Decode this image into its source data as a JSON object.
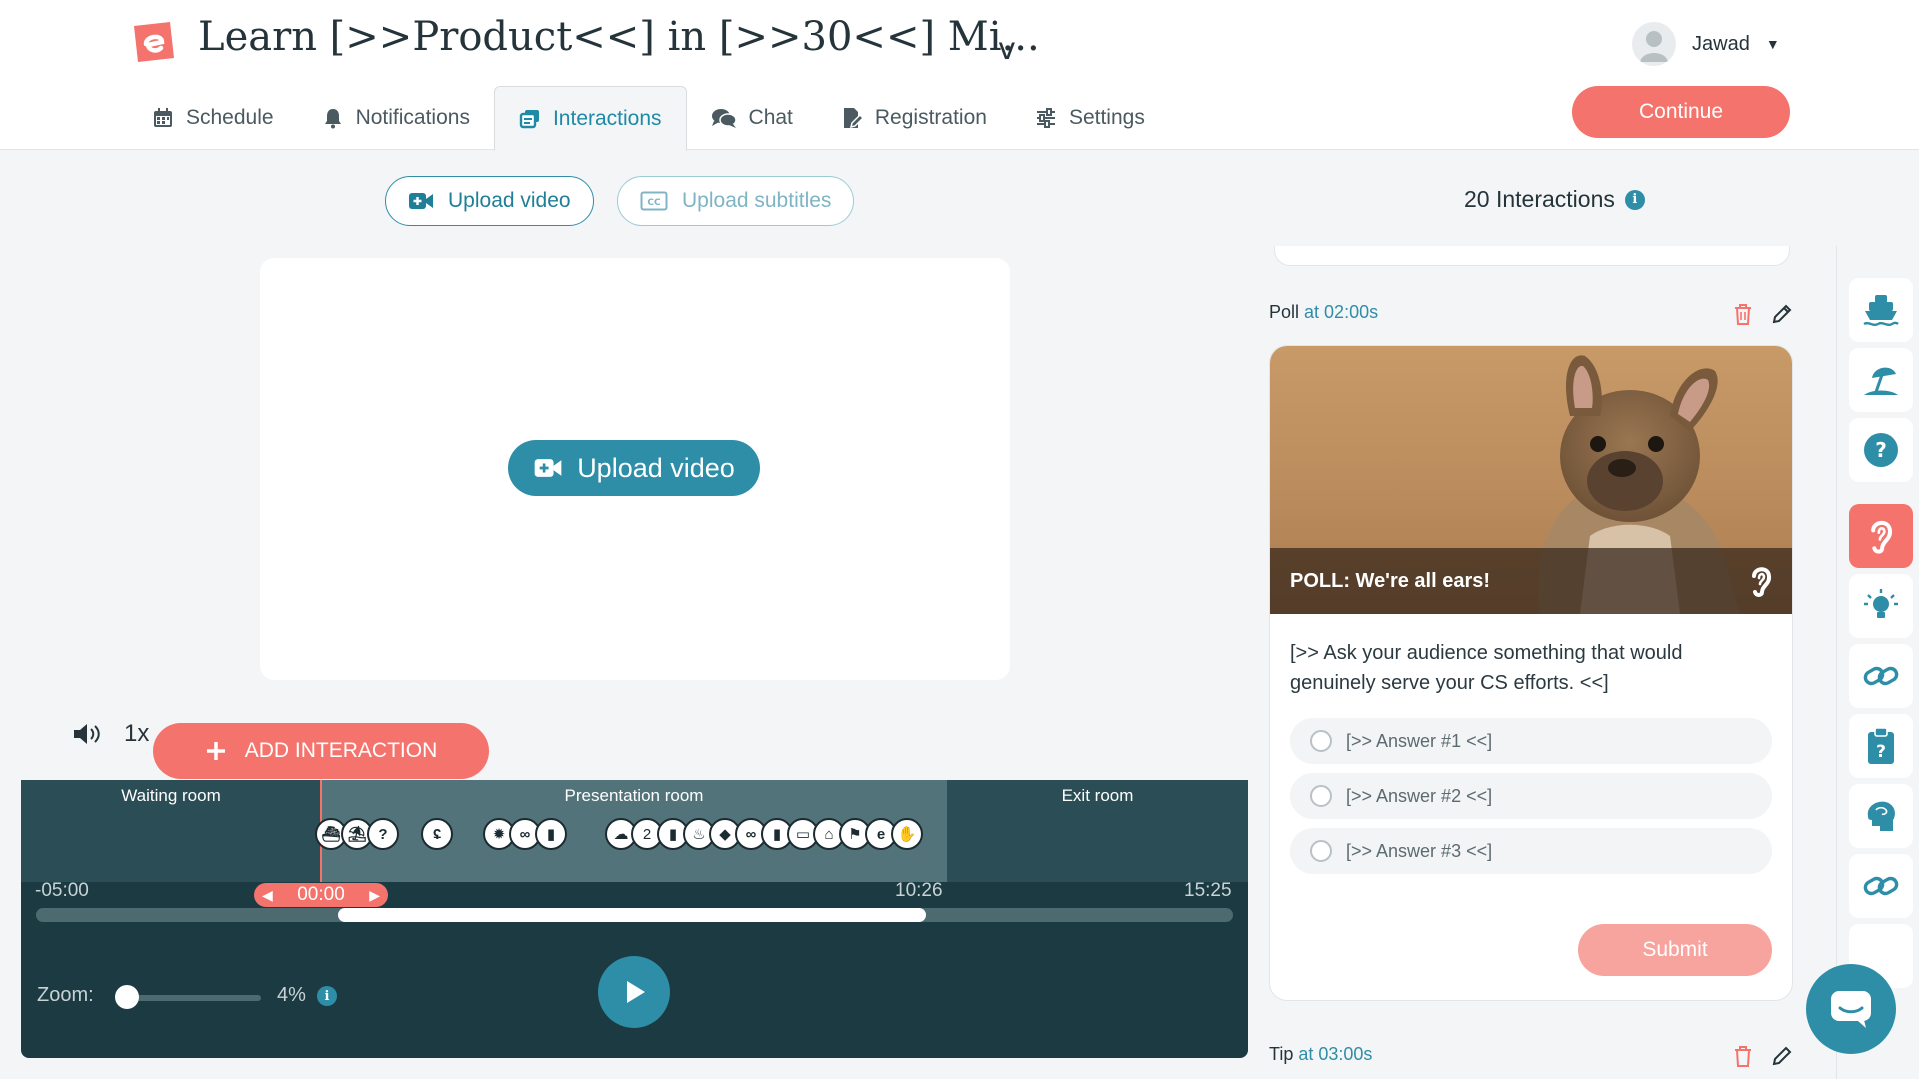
{
  "header": {
    "title": "Learn [>>Product<<] in [>>30<<] Mi...",
    "title_chevron": "v",
    "user_name": "Jawad",
    "continue_label": "Continue"
  },
  "tabs": [
    {
      "label": "Schedule",
      "icon": "calendar-icon"
    },
    {
      "label": "Notifications",
      "icon": "bell-icon"
    },
    {
      "label": "Interactions",
      "icon": "interactions-icon",
      "active": true
    },
    {
      "label": "Chat",
      "icon": "chat-icon"
    },
    {
      "label": "Registration",
      "icon": "registration-icon"
    },
    {
      "label": "Settings",
      "icon": "sliders-icon"
    }
  ],
  "toolbar": {
    "upload_video_label": "Upload video",
    "upload_subtitles_label": "Upload subtitles",
    "interactions_count": "20 Interactions"
  },
  "video": {
    "upload_label": "Upload video",
    "speed": "1x",
    "add_interaction_label": "ADD INTERACTION"
  },
  "timeline": {
    "rooms": {
      "waiting": "Waiting room",
      "presentation": "Presentation room",
      "exit": "Exit room"
    },
    "start_time": "-05:00",
    "current_time": "00:00",
    "mid_time": "10:26",
    "end_time": "15:25",
    "zoom_label": "Zoom:",
    "zoom_value": "4%",
    "presentation_badge_count": "2"
  },
  "poll_card": {
    "type_label": "Poll",
    "at_label": "at 02:00s",
    "banner_text": "POLL: We're all ears!",
    "question": "[>> Ask your audience something that would genuinely serve your CS efforts. <<]",
    "answers": [
      "[>> Answer #1 <<]",
      "[>> Answer #2 <<]",
      "[>> Answer #3 <<]"
    ],
    "submit_label": "Submit"
  },
  "next_card": {
    "type_label": "Tip",
    "at_label": "at 03:00s"
  },
  "colors": {
    "accent": "#2e8ea8",
    "coral": "#f4736c",
    "timeline_bg": "#1c3a42"
  }
}
